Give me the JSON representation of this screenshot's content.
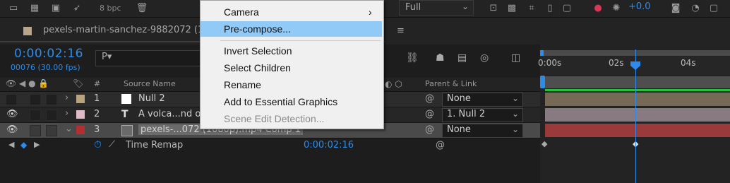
{
  "toolbar": {
    "bpc": "8 bpc",
    "resolution": "Full",
    "exposure": "+0.0"
  },
  "comp_tab": {
    "title": "pexels-martin-sanchez-9882072 (1("
  },
  "timecode": "0:00:02:16",
  "frames": "00076 (30.00 fps)",
  "search": {
    "icon": "P▾"
  },
  "columns": {
    "source_name": "Source Name",
    "parent_link": "Parent & Link"
  },
  "layers": [
    {
      "num": "1",
      "name": "Null 2",
      "parent": "None",
      "label_color": "#b7a37d"
    },
    {
      "num": "2",
      "name": "A volca...nd o",
      "parent": "1. Null 2",
      "label_color": "#e0b9c6"
    },
    {
      "num": "3",
      "name": "pexels-...072 (1080p).mp4 Comp 1",
      "parent": "None",
      "label_color": "#b32f2f"
    }
  ],
  "time_remap": {
    "label": "Time Remap",
    "value": "0:00:02:16"
  },
  "ruler": {
    "ticks": [
      "0:00s",
      "02s",
      "04s"
    ]
  },
  "context_menu": {
    "items": [
      {
        "label": "Camera",
        "submenu": true
      },
      {
        "label": "Pre-compose...",
        "highlighted": true
      },
      {
        "label": "Invert Selection"
      },
      {
        "label": "Select Children"
      },
      {
        "label": "Rename"
      },
      {
        "label": "Add to Essential Graphics"
      },
      {
        "label": "Scene Edit Detection...",
        "disabled": true
      }
    ]
  },
  "colors": {
    "accent_blue": "#2d8ceb",
    "menu_highlight": "#91c9f7",
    "track_green": "#25c13a"
  }
}
